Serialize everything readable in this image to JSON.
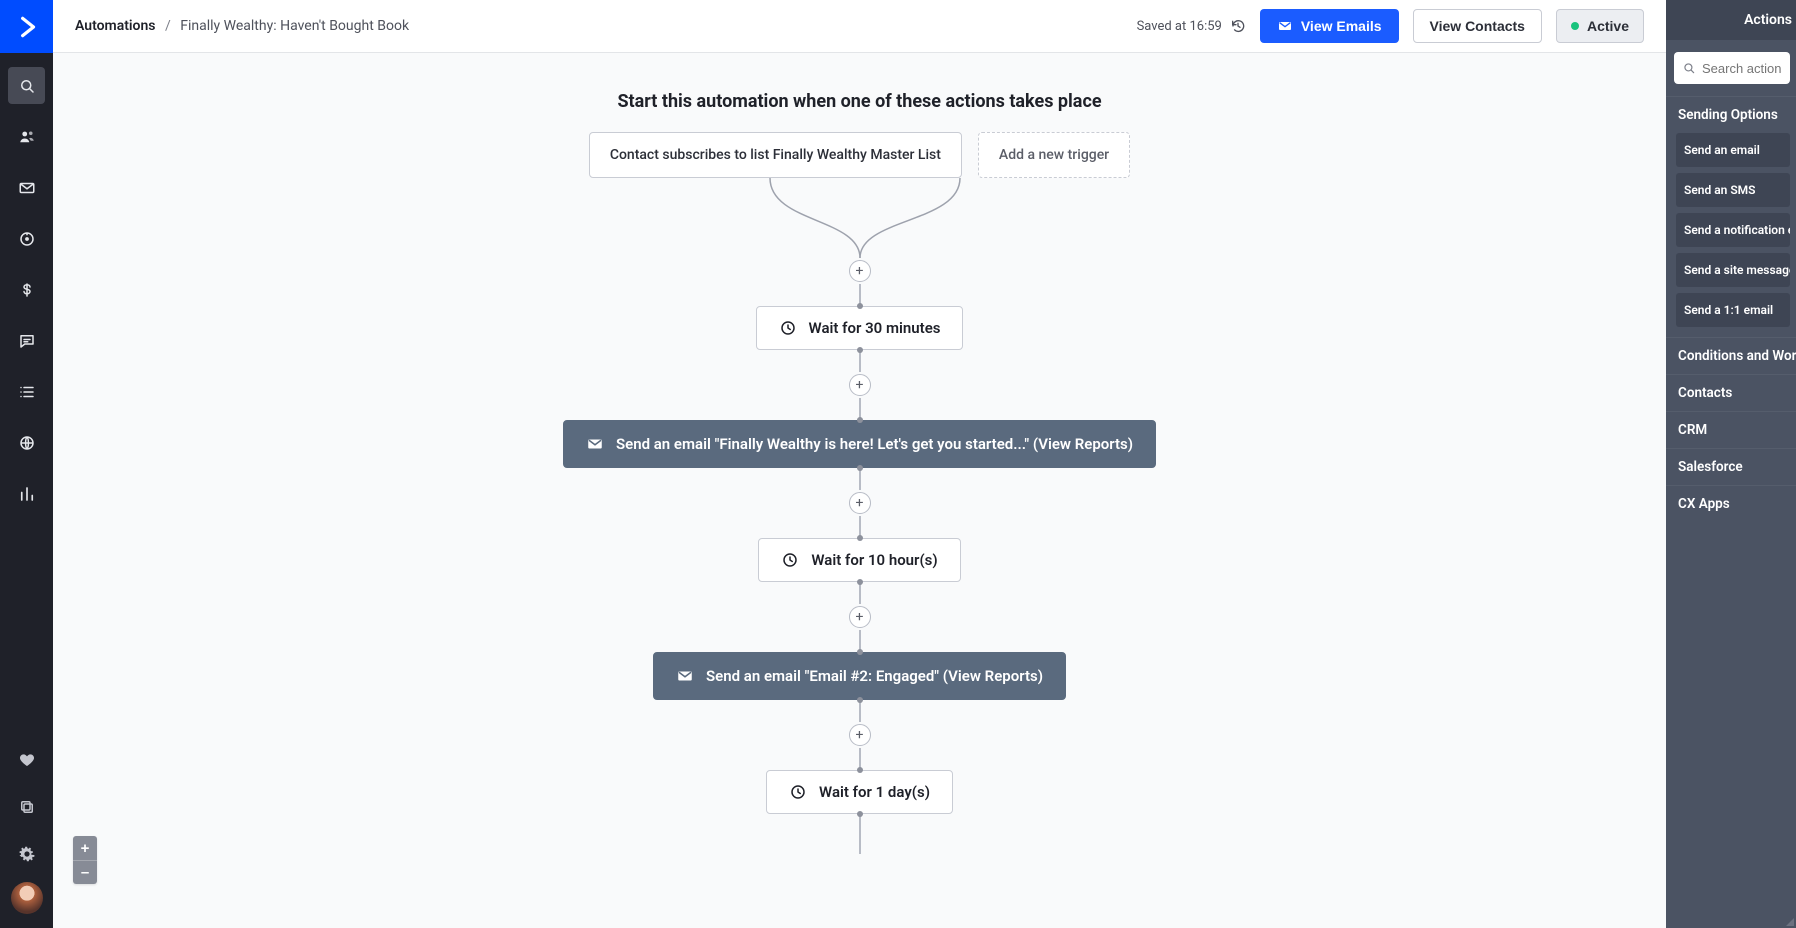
{
  "breadcrumbs": {
    "root": "Automations",
    "current": "Finally Wealthy: Haven't Bought Book"
  },
  "saved_label": "Saved at 16:59",
  "buttons": {
    "view_emails": "View Emails",
    "view_contacts": "View Contacts",
    "status_label": "Active"
  },
  "canvas": {
    "heading": "Start this automation when one of these actions takes place",
    "trigger": "Contact subscribes to list Finally Wealthy Master List",
    "add_trigger": "Add a new trigger",
    "nodes": {
      "wait30": "Wait for 30 minutes",
      "email1": "Send an email \"Finally Wealthy is here! Let's get you started...\" (View Reports)",
      "wait10h": "Wait for 10 hour(s)",
      "email2": "Send an email \"Email #2: Engaged\" (View Reports)",
      "wait1d": "Wait for 1 day(s)"
    }
  },
  "actions_panel": {
    "title": "Actions",
    "search_placeholder": "Search actions...",
    "sections": {
      "sending_options": "Sending Options",
      "conditions": "Conditions and Workflow",
      "contacts": "Contacts",
      "crm": "CRM",
      "salesforce": "Salesforce",
      "cx_apps": "CX Apps"
    },
    "sending_items": [
      "Send an email",
      "Send an SMS",
      "Send a notification email",
      "Send a site message",
      "Send a 1:1 email"
    ]
  }
}
